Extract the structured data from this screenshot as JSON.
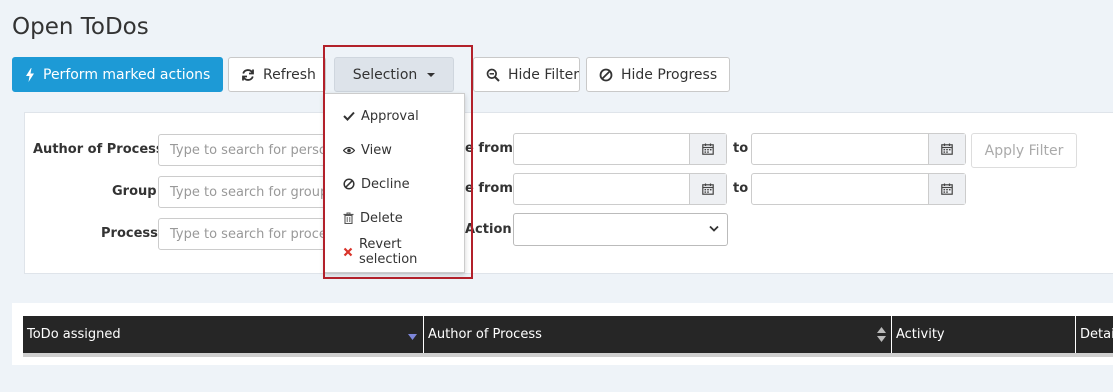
{
  "page": {
    "title": "Open ToDos"
  },
  "toolbar": {
    "perform_label": "Perform marked actions",
    "refresh_label": "Refresh",
    "selection_label": "Selection",
    "hide_filter_label": "Hide Filter",
    "hide_progress_label": "Hide Progress"
  },
  "selection_menu": {
    "items": [
      {
        "label": "Approval",
        "icon": "check-icon"
      },
      {
        "label": "View",
        "icon": "eye-icon"
      },
      {
        "label": "Decline",
        "icon": "ban-icon"
      },
      {
        "label": "Delete",
        "icon": "trash-icon"
      },
      {
        "label": "Revert selection",
        "icon": "x-icon"
      }
    ]
  },
  "filter": {
    "author_label": "Author of Process",
    "author_placeholder": "Type to search for person",
    "group_label": "Group",
    "group_placeholder": "Type to search for group",
    "process_label": "Process",
    "process_placeholder": "Type to search for process",
    "date1_label": "e from",
    "date2_label": "e from",
    "to_label": "to",
    "action_label": "Action",
    "apply_label": "Apply Filter"
  },
  "table": {
    "columns": [
      "ToDo assigned",
      "Author of Process",
      "Activity",
      "Detail"
    ]
  },
  "colors": {
    "primary": "#1d9ad6",
    "highlight": "#b2202a",
    "header": "#262626"
  }
}
